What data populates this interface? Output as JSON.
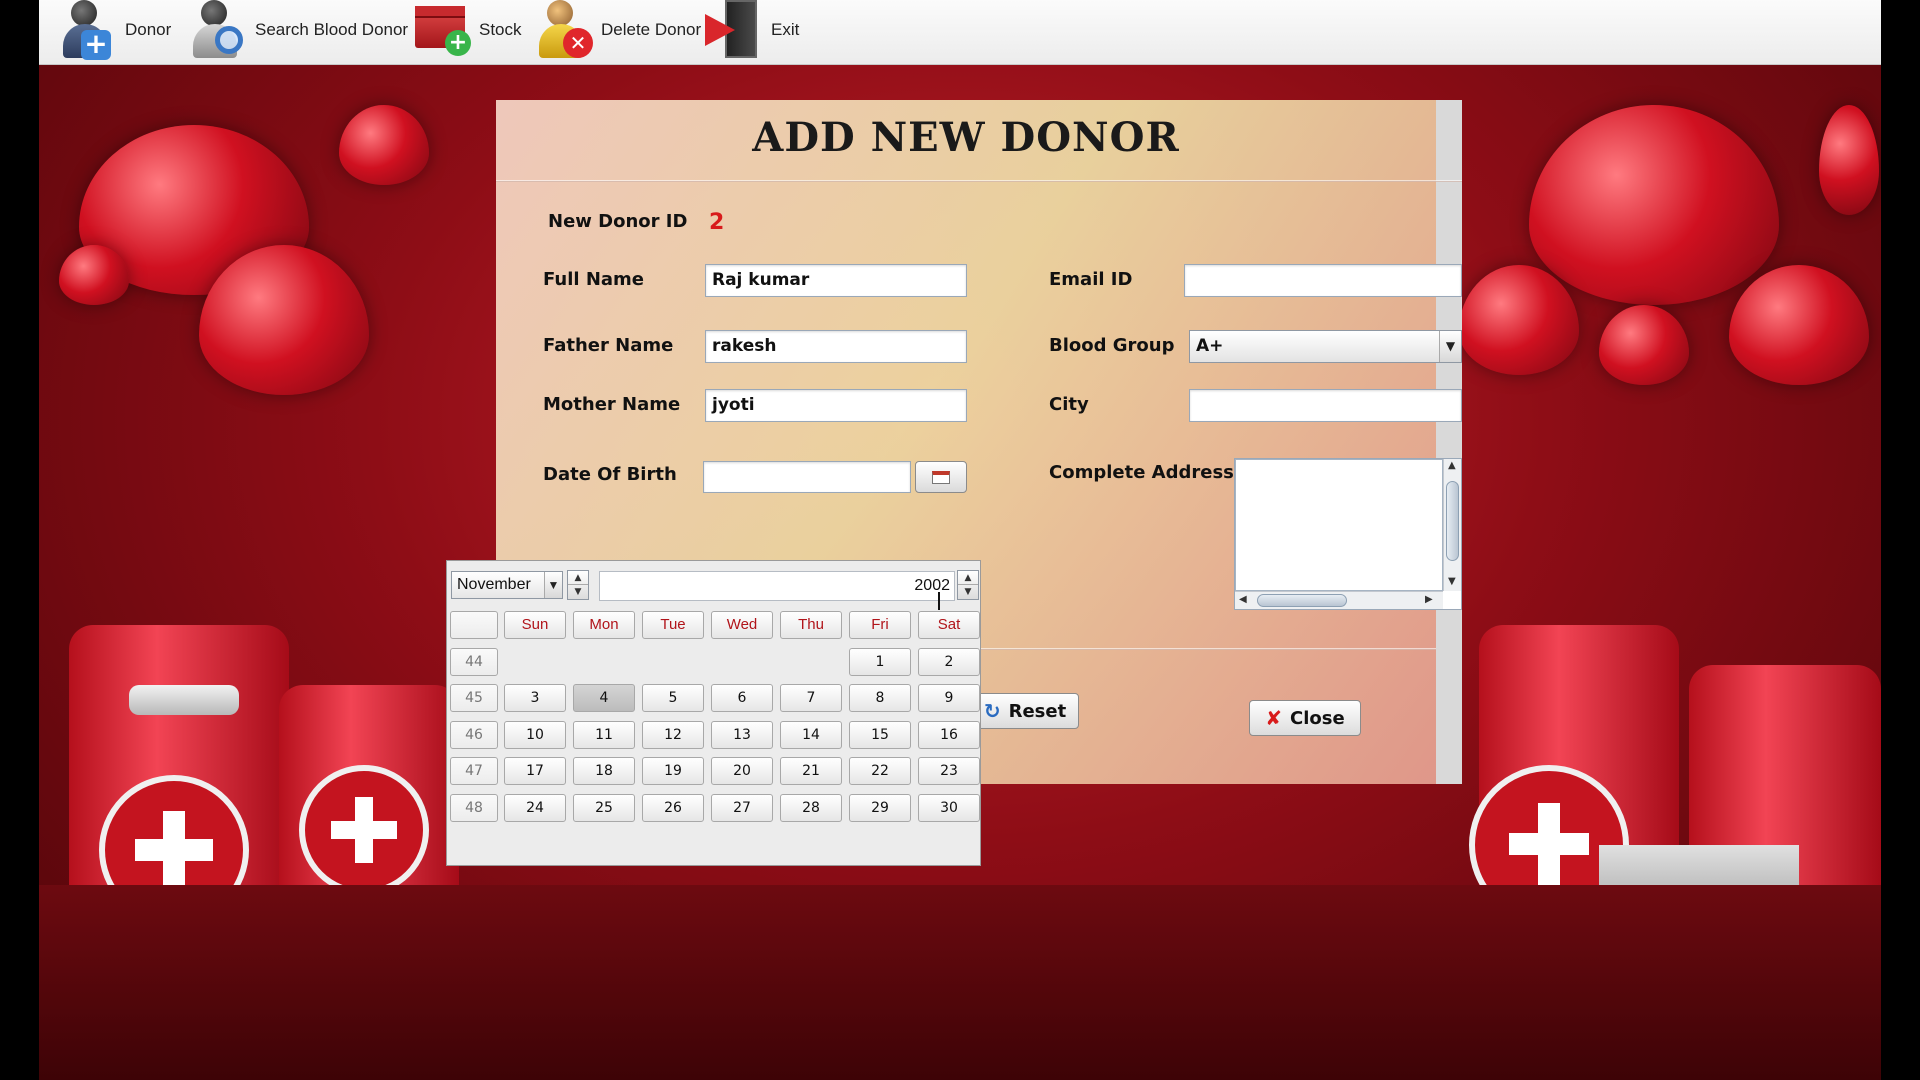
{
  "toolbar": {
    "items": [
      {
        "label": "Donor",
        "icon": "add-donor-icon"
      },
      {
        "label": "Search Blood Donor",
        "icon": "search-donor-icon"
      },
      {
        "label": "Stock",
        "icon": "stock-icon"
      },
      {
        "label": "Delete Donor",
        "icon": "delete-donor-icon"
      },
      {
        "label": "Exit",
        "icon": "exit-icon"
      }
    ]
  },
  "form": {
    "title": "ADD NEW DONOR",
    "new_donor_id_label": "New Donor ID",
    "new_donor_id_value": "2",
    "full_name_label": "Full Name",
    "full_name_value": "Raj kumar",
    "father_name_label": "Father Name",
    "father_name_value": "rakesh",
    "mother_name_label": "Mother Name",
    "mother_name_value": "jyoti",
    "dob_label": "Date Of Birth",
    "dob_value": "",
    "email_label": "Email ID",
    "email_value": "",
    "blood_group_label": "Blood Group",
    "blood_group_value": "A+",
    "city_label": "City",
    "city_value": "",
    "address_label": "Complete Address",
    "address_value": "",
    "reset_label": "Reset",
    "close_label": "Close"
  },
  "calendar": {
    "month": "November",
    "year": "2002",
    "day_headers": [
      "Sun",
      "Mon",
      "Tue",
      "Wed",
      "Thu",
      "Fri",
      "Sat"
    ],
    "weeks": [
      {
        "week": "44",
        "days": [
          "",
          "",
          "",
          "",
          "",
          "1",
          "2"
        ]
      },
      {
        "week": "45",
        "days": [
          "3",
          "4",
          "5",
          "6",
          "7",
          "8",
          "9"
        ]
      },
      {
        "week": "46",
        "days": [
          "10",
          "11",
          "12",
          "13",
          "14",
          "15",
          "16"
        ]
      },
      {
        "week": "47",
        "days": [
          "17",
          "18",
          "19",
          "20",
          "21",
          "22",
          "23"
        ]
      },
      {
        "week": "48",
        "days": [
          "24",
          "25",
          "26",
          "27",
          "28",
          "29",
          "30"
        ]
      }
    ],
    "selected_day": "4"
  },
  "colors": {
    "accent_red": "#d81b1b",
    "header_red": "#b1141a"
  }
}
